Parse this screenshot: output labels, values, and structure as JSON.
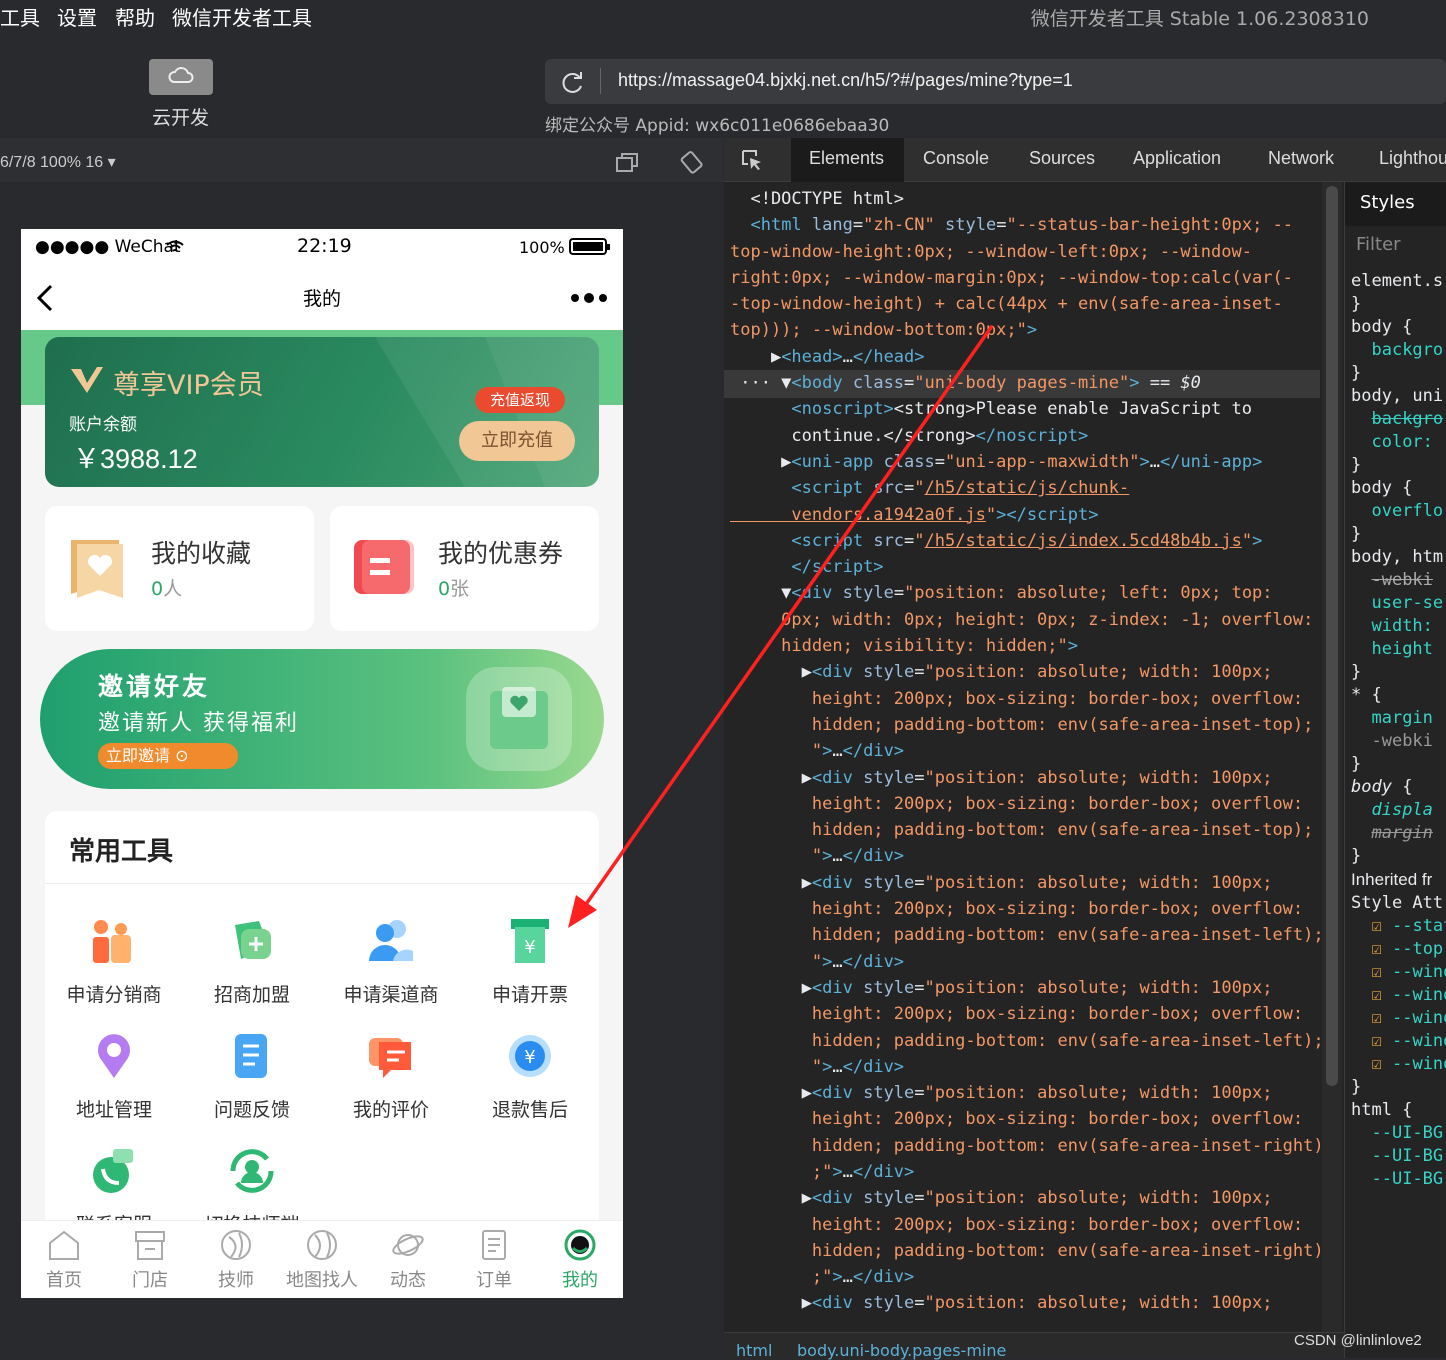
{
  "menu": [
    "工具",
    "设置",
    "帮助",
    "微信开发者工具"
  ],
  "window_title": "微信开发者工具 Stable 1.06.2308310",
  "toolbar": {
    "cloud_label": "云开发",
    "url": "https://massage04.bjxkj.net.cn/h5/?#/pages/mine?type=1",
    "appid": "绑定公众号 Appid: wx6c011e0686ebaa30"
  },
  "simulator": {
    "device_info": "6/7/8 100% 16 ▾"
  },
  "phone": {
    "status": {
      "carrier": "●●●●● WeChat",
      "time": "22:19",
      "battery": "100%"
    },
    "nav_title": "我的",
    "vip": {
      "title": "尊享VIP会员",
      "balance_label": "账户余额",
      "balance": "￥3988.12",
      "tag": "充值返现",
      "recharge": "立即充值"
    },
    "favorites": {
      "title": "我的收藏",
      "count": "0",
      "unit": "人"
    },
    "coupons": {
      "title": "我的优惠券",
      "count": "0",
      "unit": "张"
    },
    "invite": {
      "title": "邀请好友",
      "subtitle": "邀请新人 获得福利",
      "button": "立即邀请"
    },
    "tools_title": "常用工具",
    "tools": [
      "申请分销商",
      "招商加盟",
      "申请渠道商",
      "申请开票",
      "地址管理",
      "问题反馈",
      "我的评价",
      "退款售后",
      "联系客服",
      "切换技师端"
    ],
    "tabbar": [
      "首页",
      "门店",
      "技师",
      "地图找人",
      "动态",
      "订单",
      "我的"
    ]
  },
  "devtools": {
    "tabs": [
      "Elements",
      "Console",
      "Sources",
      "Application",
      "Network",
      "Lighthou"
    ],
    "breadcrumb": [
      "html",
      "body.uni-body.pages-mine"
    ],
    "styles_tab": "Styles",
    "filter": "Filter",
    "watermark": "CSDN @linlinlove2"
  },
  "colors": {
    "accent_green": "#2aa866",
    "vip_gold": "#f2c796",
    "tag_red": "#ea4b2e",
    "arrow": "#ff2020"
  }
}
